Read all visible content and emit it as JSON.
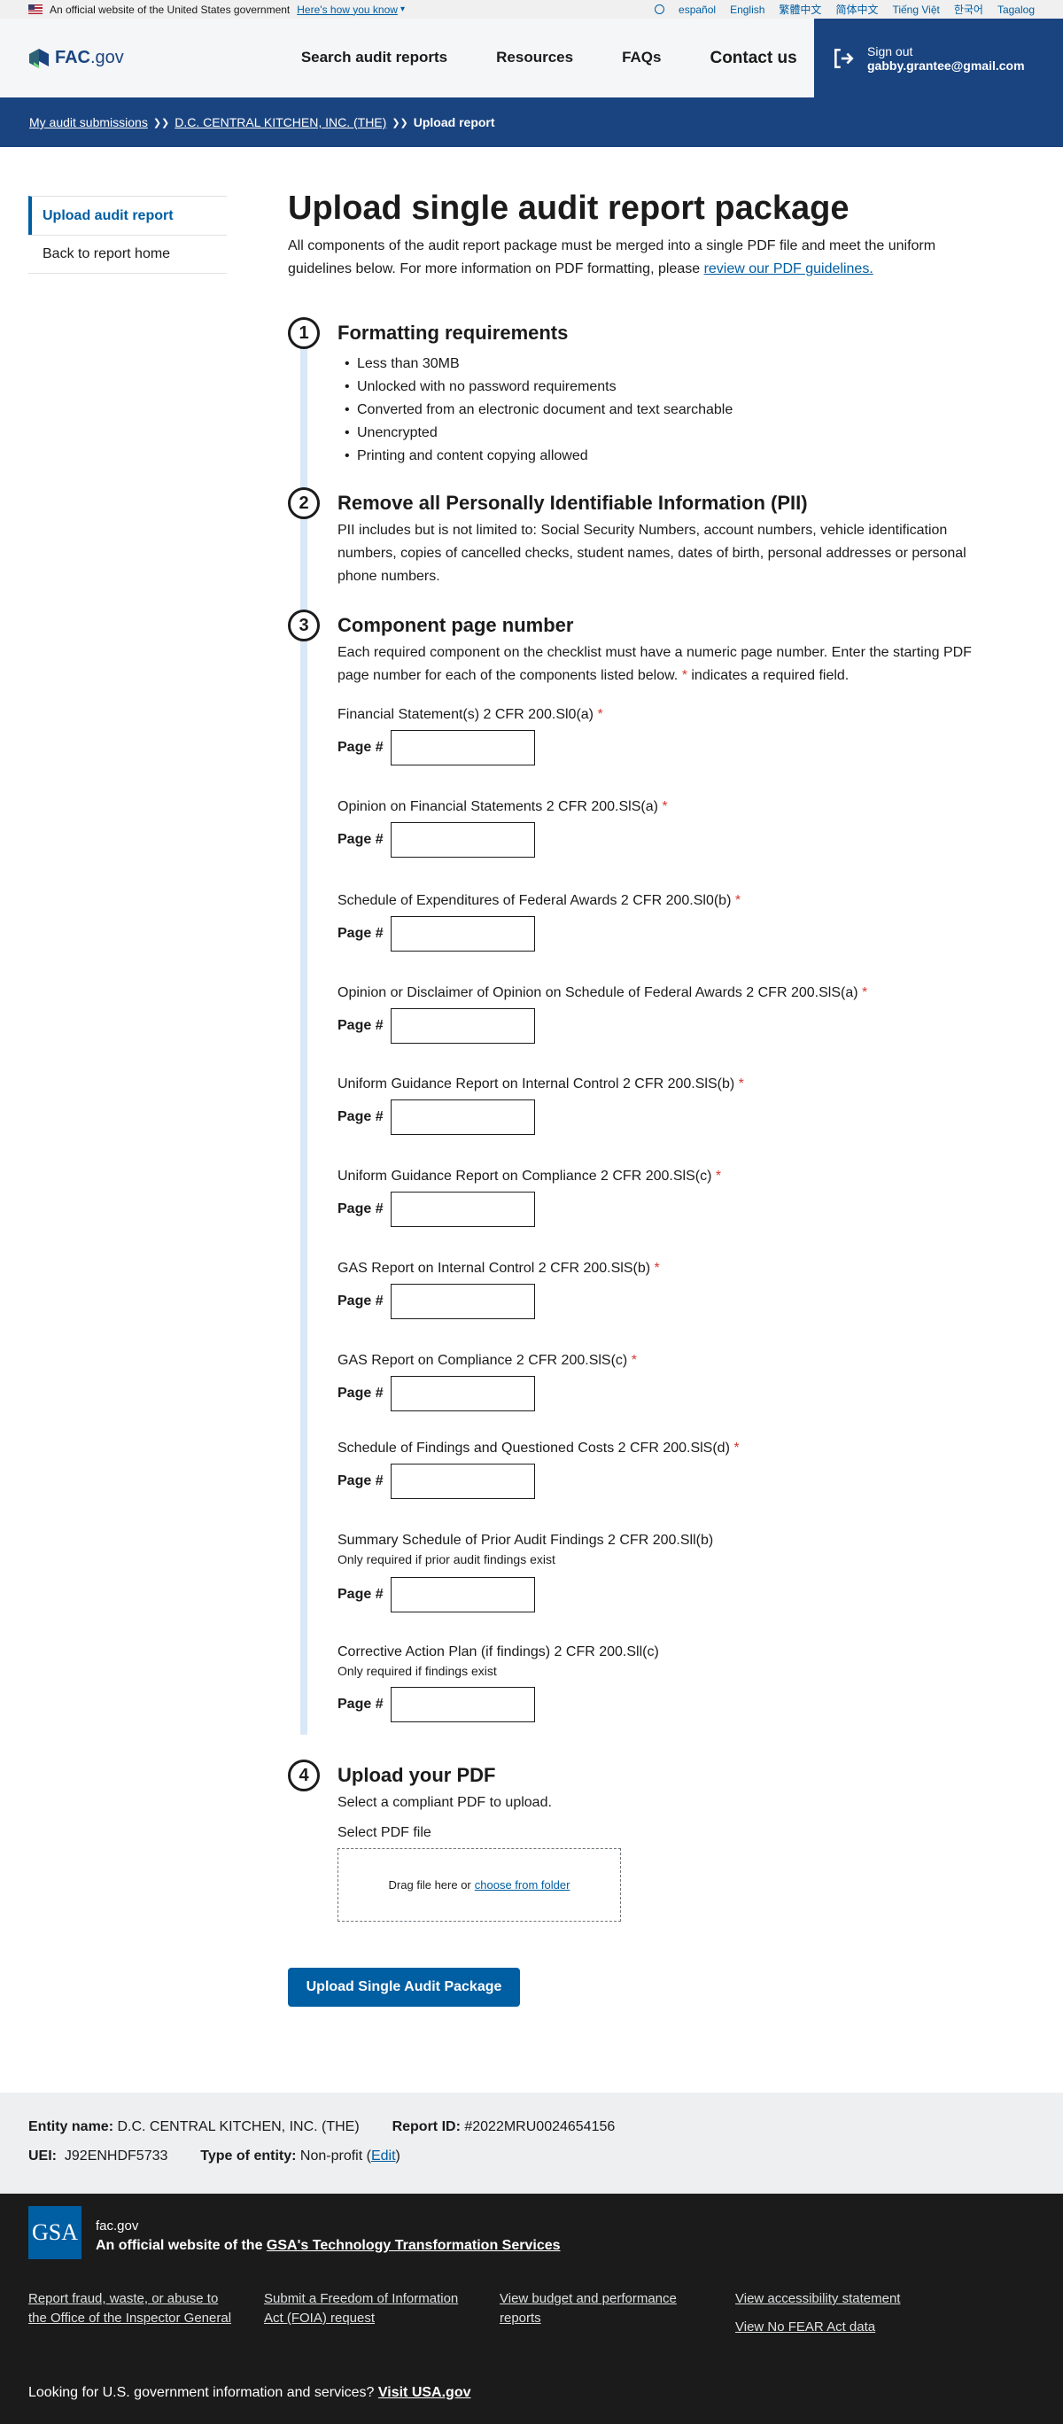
{
  "banner": {
    "official_text": "An official website of the United States government",
    "how_link": "Here's how you know",
    "languages": [
      "español",
      "English",
      "繁體中文",
      "简体中文",
      "Tiếng Việt",
      "한국어",
      "Tagalog"
    ]
  },
  "header": {
    "logo_fac": "FAC",
    "logo_gov": ".gov",
    "nav": [
      "Search audit reports",
      "Resources",
      "FAQs",
      "Contact us"
    ],
    "signout_label": "Sign out",
    "signout_email": "gabby.grantee@gmail.com"
  },
  "breadcrumb": {
    "items": [
      "My audit submissions",
      "D.C. CENTRAL KITCHEN, INC. (THE)"
    ],
    "current": "Upload report"
  },
  "sidenav": {
    "items": [
      "Upload audit report",
      "Back to report home"
    ]
  },
  "main": {
    "title": "Upload single audit report package",
    "intro": "All components of the audit report package must be merged into a single PDF file and meet the uniform guidelines below. For more information on PDF formatting, please ",
    "intro_link": "review our PDF guidelines."
  },
  "steps": {
    "s1": {
      "num": "1",
      "title": "Formatting requirements",
      "items": [
        "Less than 30MB",
        "Unlocked with no password requirements",
        "Converted from an electronic document and text searchable",
        "Unencrypted",
        "Printing and content copying allowed"
      ]
    },
    "s2": {
      "num": "2",
      "title": "Remove all Personally Identifiable Information (PII)",
      "text": "PII includes but is not limited to: Social Security Numbers, account numbers, vehicle identification numbers, copies of cancelled checks, student names, dates of birth, personal addresses or personal phone numbers."
    },
    "s3": {
      "num": "3",
      "title": "Component page number",
      "text": "Each required component on the checklist must have a numeric page number. Enter the starting PDF page number for each of the components listed below. ",
      "req_mark": "*",
      "text_end": " indicates a required field.",
      "page_label": "Page #",
      "fields": [
        {
          "label": "Financial Statement(s) 2 CFR 200.Sl0(a)",
          "req": "*"
        },
        {
          "label": "Opinion on Financial Statements 2 CFR 200.SlS(a)",
          "req": "*"
        },
        {
          "label": "Schedule of Expenditures of Federal Awards 2 CFR 200.Sl0(b)",
          "req": "*"
        },
        {
          "label": "Opinion or Disclaimer of Opinion on Schedule of Federal Awards 2 CFR 200.SlS(a)",
          "req": "*"
        },
        {
          "label": "Uniform Guidance Report on Internal Control 2 CFR 200.SlS(b)",
          "req": "*"
        },
        {
          "label": "Uniform Guidance Report on Compliance 2 CFR 200.SlS(c)",
          "req": "*"
        },
        {
          "label": "GAS Report on Internal Control 2 CFR 200.SlS(b)",
          "req": "*"
        },
        {
          "label": "GAS Report on Compliance 2 CFR 200.SlS(c)",
          "req": "*"
        },
        {
          "label": "Schedule of Findings and Questioned Costs 2 CFR 200.SlS(d)",
          "req": "*"
        },
        {
          "label": "Summary Schedule of Prior Audit Findings 2 CFR 200.Sll(b)",
          "hint": "Only required if prior audit findings exist"
        },
        {
          "label": "Corrective Action Plan (if findings) 2 CFR 200.Sll(c)",
          "hint": "Only required if findings exist"
        }
      ]
    },
    "s4": {
      "num": "4",
      "title": "Upload your PDF",
      "text": "Select a compliant PDF to upload.",
      "file_label": "Select PDF file",
      "drop_text": "Drag file here or",
      "drop_link": "choose from folder"
    }
  },
  "submit_label": "Upload Single Audit Package",
  "entity": {
    "name_label": "Entity name:",
    "name": "D.C. CENTRAL KITCHEN, INC. (THE)",
    "report_label": "Report ID:",
    "report_id": "#2022MRU0024654156",
    "uei_label": "UEI:",
    "uei": "J92ENHDF5733",
    "type_label": "Type of entity:",
    "type": "Non-profit",
    "edit": "Edit"
  },
  "footer": {
    "logo": "GSA",
    "site": "fac.gov",
    "official_prefix": "An official website of the ",
    "official_link": "GSA's Technology Transformation Services",
    "links": {
      "c1": [
        "Report fraud, waste, or abuse to the Office of the Inspector General"
      ],
      "c2": [
        "Submit a Freedom of Information Act (FOIA) request"
      ],
      "c3": [
        "View budget and performance reports"
      ],
      "c4": [
        "View accessibility statement",
        "View No FEAR Act data"
      ]
    },
    "usa_text": "Looking for U.S. government information and services?",
    "usa_link": "Visit USA.gov"
  },
  "colors": {
    "primary": "#005ea2",
    "navy": "#1a4480",
    "required": "#d83933",
    "rail": "#d9e8f6"
  }
}
